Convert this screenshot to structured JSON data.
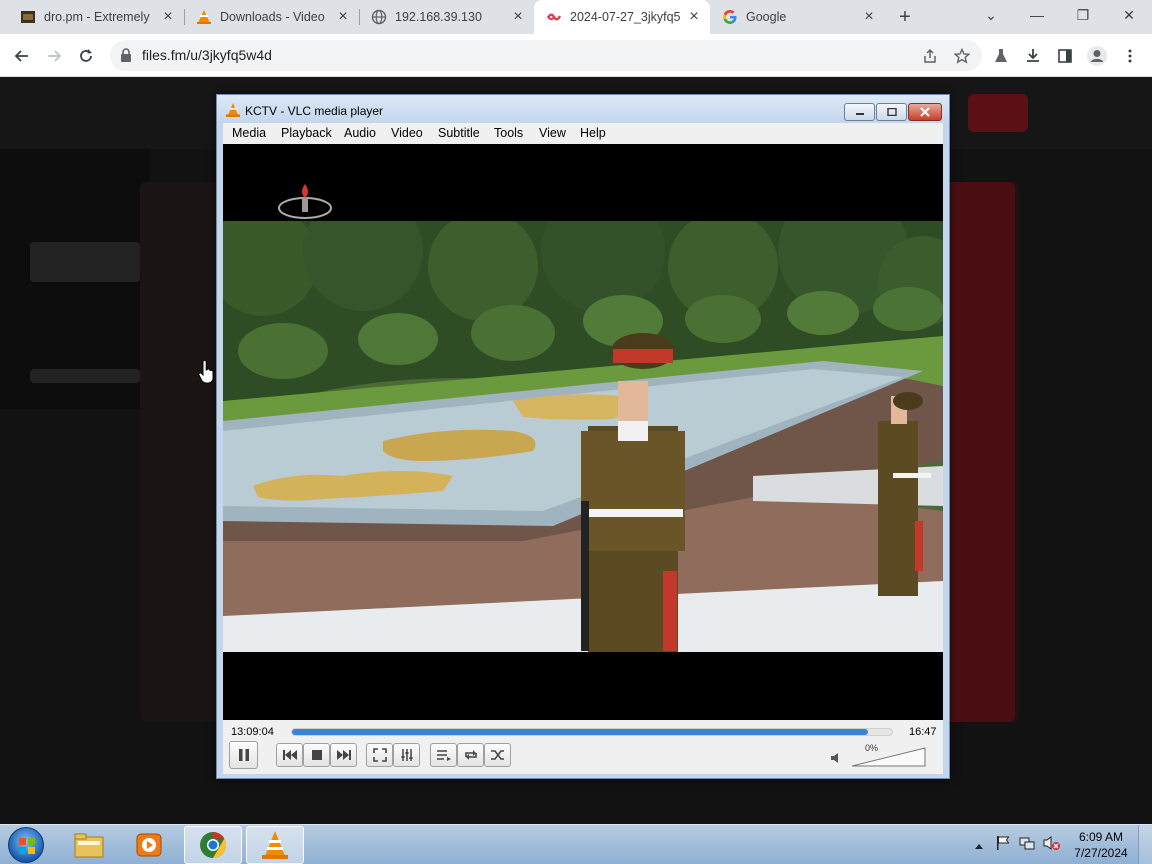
{
  "browser": {
    "tabs": [
      {
        "title": "dro.pm - Extremely",
        "icon": "dro-favicon"
      },
      {
        "title": "Downloads - Video",
        "icon": "vlc-cone-icon"
      },
      {
        "title": "192.168.39.130",
        "icon": "globe-icon"
      },
      {
        "title": "2024-07-27_3jkyfq5",
        "icon": "filesfm-icon",
        "active": true
      },
      {
        "title": "Google",
        "icon": "google-icon"
      }
    ],
    "new_tab": "+",
    "window_controls": {
      "dropdown": "⌄",
      "minimize": "—",
      "restore": "❐",
      "close": "✕"
    },
    "url": "files.fm/u/3jkyfq5w4d"
  },
  "vlc": {
    "title": "KCTV - VLC media player",
    "menu": [
      "Media",
      "Playback",
      "Audio",
      "Video",
      "Subtitle",
      "Tools",
      "View",
      "Help"
    ],
    "elapsed": "13:09:04",
    "remaining": "16:47",
    "progress": 0.96,
    "volume_text": "0%",
    "volume": 0
  },
  "taskbar": {
    "time": "6:09 AM",
    "date": "7/27/2024",
    "pinned": [
      "windows-explorer",
      "media-player",
      "chrome",
      "vlc"
    ]
  },
  "colors": {
    "seek_fill": "#3b83d3",
    "taskbar": "#a8c1dc",
    "tab_strip": "#dee1e6"
  }
}
